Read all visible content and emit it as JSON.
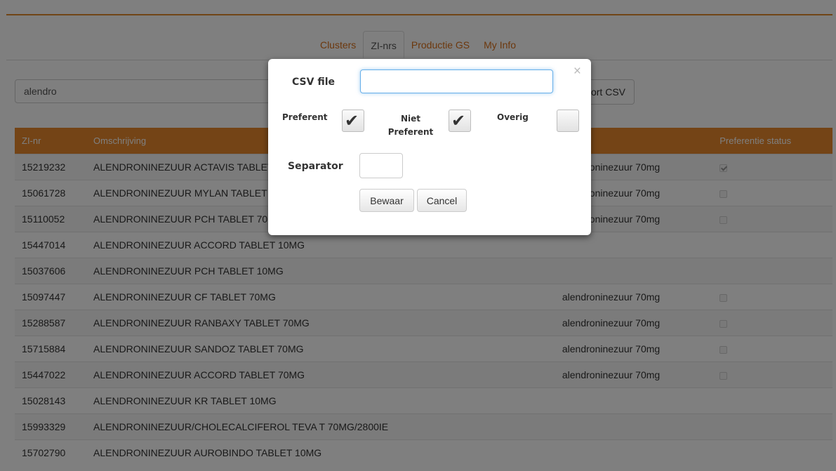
{
  "tabs": [
    {
      "label": "Clusters"
    },
    {
      "label": "ZI-nrs"
    },
    {
      "label": "Productie GS"
    },
    {
      "label": "My Info"
    }
  ],
  "search": {
    "value": "alendro"
  },
  "export_button": {
    "label": "Export CSV"
  },
  "table": {
    "headers": [
      "ZI-nr",
      "Omschrijving",
      "",
      "Preferentie status"
    ],
    "rows": [
      {
        "zi": "15219232",
        "oms": "ALENDRONINEZUUR ACTAVIS TABLET 70MG",
        "gs": "alendroninezuur 70mg",
        "checked": true,
        "has_cb": true
      },
      {
        "zi": "15061728",
        "oms": "ALENDRONINEZUUR MYLAN TABLET 70MG",
        "gs": "alendroninezuur 70mg",
        "checked": false,
        "has_cb": true
      },
      {
        "zi": "15110052",
        "oms": "ALENDRONINEZUUR PCH TABLET 70MG",
        "gs": "alendroninezuur 70mg",
        "checked": false,
        "has_cb": true
      },
      {
        "zi": "15447014",
        "oms": "ALENDRONINEZUUR ACCORD TABLET 10MG",
        "gs": "",
        "checked": false,
        "has_cb": false
      },
      {
        "zi": "15037606",
        "oms": "ALENDRONINEZUUR PCH TABLET 10MG",
        "gs": "",
        "checked": false,
        "has_cb": false
      },
      {
        "zi": "15097447",
        "oms": "ALENDRONINEZUUR CF TABLET 70MG",
        "gs": "alendroninezuur 70mg",
        "checked": false,
        "has_cb": true
      },
      {
        "zi": "15288587",
        "oms": "ALENDRONINEZUUR RANBAXY TABLET 70MG",
        "gs": "alendroninezuur 70mg",
        "checked": false,
        "has_cb": true
      },
      {
        "zi": "15715884",
        "oms": "ALENDRONINEZUUR SANDOZ TABLET 70MG",
        "gs": "alendroninezuur 70mg",
        "checked": false,
        "has_cb": true
      },
      {
        "zi": "15447022",
        "oms": "ALENDRONINEZUUR ACCORD TABLET 70MG",
        "gs": "alendroninezuur 70mg",
        "checked": false,
        "has_cb": true
      },
      {
        "zi": "15028143",
        "oms": "ALENDRONINEZUUR KR TABLET 10MG",
        "gs": "",
        "checked": false,
        "has_cb": false
      },
      {
        "zi": "15993329",
        "oms": "ALENDRONINEZUUR/CHOLECALCIFEROL TEVA T 70MG/2800IE",
        "gs": "",
        "checked": false,
        "has_cb": false
      },
      {
        "zi": "15702790",
        "oms": "ALENDRONINEZUUR AUROBINDO TABLET 10MG",
        "gs": "",
        "checked": false,
        "has_cb": false
      }
    ]
  },
  "modal": {
    "close_glyph": "×",
    "csv_label": "CSV file",
    "csv_value": "",
    "preferent_label": "Preferent",
    "preferent_checked": true,
    "niet_label_line1": "Niet",
    "niet_label_line2": "Preferent",
    "niet_checked": true,
    "overig_label": "Overig",
    "overig_checked": false,
    "separator_label": "Separator",
    "separator_value": "",
    "save_label": "Bewaar",
    "cancel_label": "Cancel",
    "check_glyph": "✔"
  },
  "colors": {
    "accent": "#e8882c",
    "link": "#d9701b"
  }
}
